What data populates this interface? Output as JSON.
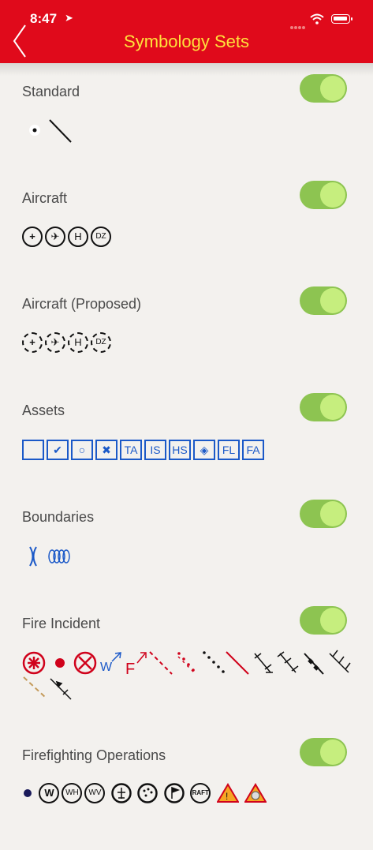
{
  "status": {
    "time": "8:47",
    "location_icon": "location-arrow-icon"
  },
  "header": {
    "title": "Symbology Sets",
    "back_icon": "chevron-left-icon"
  },
  "colors": {
    "header": "#e00a1b",
    "title": "#ffe13b",
    "toggle_on": "#8dc451",
    "asset_blue": "#1b59c8",
    "fire_red": "#d0021b"
  },
  "sections": [
    {
      "label": "Standard",
      "enabled": true
    },
    {
      "label": "Aircraft",
      "enabled": true,
      "icons": [
        "+",
        "✈",
        "H",
        "DZ"
      ]
    },
    {
      "label": "Aircraft (Proposed)",
      "enabled": true,
      "icons": [
        "+",
        "✈",
        "H",
        "DZ"
      ]
    },
    {
      "label": "Assets",
      "enabled": true,
      "icons": [
        "",
        "✔",
        "○",
        "✖",
        "TA",
        "IS",
        "HS",
        "◈",
        "FL",
        "FA"
      ]
    },
    {
      "label": "Boundaries",
      "enabled": true
    },
    {
      "label": "Fire Incident",
      "enabled": true,
      "wind_label": "W",
      "fire_label": "F"
    },
    {
      "label": "Firefighting Operations",
      "enabled": true,
      "icons": [
        "W",
        "WH",
        "WV",
        "RAFT"
      ]
    }
  ]
}
